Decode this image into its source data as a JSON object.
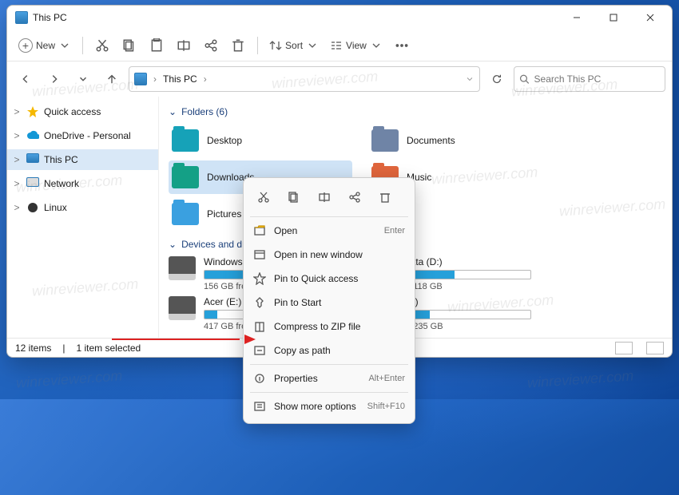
{
  "window": {
    "title": "This PC"
  },
  "toolbar": {
    "new": "New",
    "sort": "Sort",
    "view": "View"
  },
  "breadcrumb": {
    "root": "This PC"
  },
  "search": {
    "placeholder": "Search This PC"
  },
  "sidebar": [
    {
      "label": "Quick access",
      "icon": "star",
      "expand": ">"
    },
    {
      "label": "OneDrive - Personal",
      "icon": "cloud",
      "expand": ">"
    },
    {
      "label": "This PC",
      "icon": "pc",
      "expand": ">",
      "selected": true
    },
    {
      "label": "Network",
      "icon": "network",
      "expand": ">"
    },
    {
      "label": "Linux",
      "icon": "linux",
      "expand": ">"
    }
  ],
  "groups": {
    "folders": {
      "label": "Folders (6)"
    },
    "devices": {
      "label": "Devices and drives"
    }
  },
  "folders": [
    {
      "label": "Desktop",
      "color": "c-teal"
    },
    {
      "label": "Documents",
      "color": "c-blue"
    },
    {
      "label": "Downloads",
      "color": "c-teal2",
      "selected": true
    },
    {
      "label": "Music",
      "color": "c-or"
    },
    {
      "label": "Pictures",
      "color": "c-sky"
    }
  ],
  "drives": [
    {
      "name": "Windows (C:)",
      "free": "156 GB free",
      "fill": 34
    },
    {
      "name": "Data (D:)",
      "free": "of 118 GB",
      "fill": 40
    },
    {
      "name": "Acer (E:)",
      "free": "417 GB free",
      "fill": 10
    },
    {
      "name": "(F:)",
      "free": "of 235 GB",
      "fill": 20
    }
  ],
  "context": {
    "items": [
      {
        "label": "Open",
        "shortcut": "Enter",
        "icon": "open"
      },
      {
        "label": "Open in new window",
        "shortcut": "",
        "icon": "window"
      },
      {
        "label": "Pin to Quick access",
        "shortcut": "",
        "icon": "star"
      },
      {
        "label": "Pin to Start",
        "shortcut": "",
        "icon": "pin"
      },
      {
        "label": "Compress to ZIP file",
        "shortcut": "",
        "icon": "zip"
      },
      {
        "label": "Copy as path",
        "shortcut": "",
        "icon": "path"
      },
      {
        "label": "Properties",
        "shortcut": "Alt+Enter",
        "icon": "props"
      },
      {
        "label": "Show more options",
        "shortcut": "Shift+F10",
        "icon": "more"
      }
    ]
  },
  "status": {
    "items_count": "12 items",
    "selected": "1 item selected"
  },
  "watermark": "winreviewer.com"
}
